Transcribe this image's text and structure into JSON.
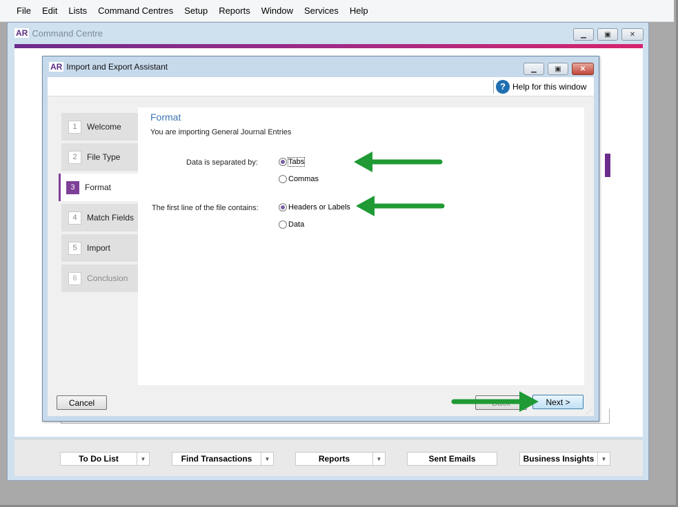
{
  "menubar": {
    "items": [
      "File",
      "Edit",
      "Lists",
      "Command Centres",
      "Setup",
      "Reports",
      "Window",
      "Services",
      "Help"
    ]
  },
  "command_centre": {
    "logo": "AR",
    "title": "Command Centre"
  },
  "dialog": {
    "logo": "AR",
    "title": "Import and Export Assistant",
    "help_label": "Help for this window",
    "help_icon": "?",
    "steps": [
      {
        "num": "1",
        "label": "Welcome",
        "state": "normal"
      },
      {
        "num": "2",
        "label": "File Type",
        "state": "normal"
      },
      {
        "num": "3",
        "label": "Format",
        "state": "active"
      },
      {
        "num": "4",
        "label": "Match Fields",
        "state": "normal"
      },
      {
        "num": "5",
        "label": "Import",
        "state": "normal"
      },
      {
        "num": "6",
        "label": "Conclusion",
        "state": "disabled"
      }
    ],
    "heading": "Format",
    "subheading": "You are importing General Journal Entries",
    "separator": {
      "label": "Data is separated by:",
      "options": [
        {
          "label": "Tabs",
          "selected": true
        },
        {
          "label": "Commas",
          "selected": false
        }
      ]
    },
    "first_line": {
      "label": "The first line of the file contains:",
      "options": [
        {
          "label": "Headers or Labels",
          "selected": true
        },
        {
          "label": "Data",
          "selected": false
        }
      ]
    },
    "cancel_label": "Cancel",
    "back_label": "Back",
    "next_label": "Next >"
  },
  "bottom_bar": {
    "buttons": [
      {
        "label": "To Do List",
        "dropdown": true
      },
      {
        "label": "Find Transactions",
        "dropdown": true
      },
      {
        "label": "Reports",
        "dropdown": true
      },
      {
        "label": "Sent Emails",
        "dropdown": false
      },
      {
        "label": "Business Insights",
        "dropdown": true
      }
    ]
  },
  "colors": {
    "accent": "#7e3f98",
    "arrow": "#1f9a34",
    "heading": "#3d77b5"
  }
}
